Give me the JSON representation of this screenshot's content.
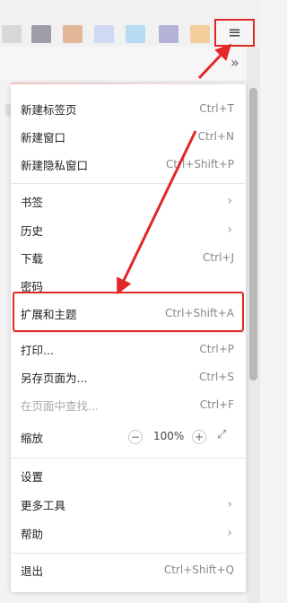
{
  "menu": {
    "items": [
      {
        "label": "新建标签页",
        "shortcut": "Ctrl+T"
      },
      {
        "label": "新建窗口",
        "shortcut": "Ctrl+N"
      },
      {
        "label": "新建隐私窗口",
        "shortcut": "Ctrl+Shift+P"
      },
      {
        "label": "书签",
        "shortcut": ""
      },
      {
        "label": "历史",
        "shortcut": ""
      },
      {
        "label": "下载",
        "shortcut": "Ctrl+J"
      },
      {
        "label": "密码",
        "shortcut": ""
      },
      {
        "label": "扩展和主题",
        "shortcut": "Ctrl+Shift+A"
      },
      {
        "label": "打印...",
        "shortcut": "Ctrl+P"
      },
      {
        "label": "另存页面为...",
        "shortcut": "Ctrl+S"
      },
      {
        "label": "在页面中查找...",
        "shortcut": "Ctrl+F"
      },
      {
        "label": "缩放",
        "shortcut": ""
      },
      {
        "label": "设置",
        "shortcut": ""
      },
      {
        "label": "更多工具",
        "shortcut": ""
      },
      {
        "label": "帮助",
        "shortcut": ""
      },
      {
        "label": "退出",
        "shortcut": "Ctrl+Shift+Q"
      }
    ],
    "zoom": {
      "value": "100%",
      "minus": "−",
      "plus": "+"
    }
  },
  "toolbar": {
    "menu_icon": "≡",
    "overflow_icon": "»"
  },
  "icons": {
    "chevron": "›",
    "fullscreen": "⤢"
  },
  "colors": {
    "highlight": "#e32626"
  }
}
